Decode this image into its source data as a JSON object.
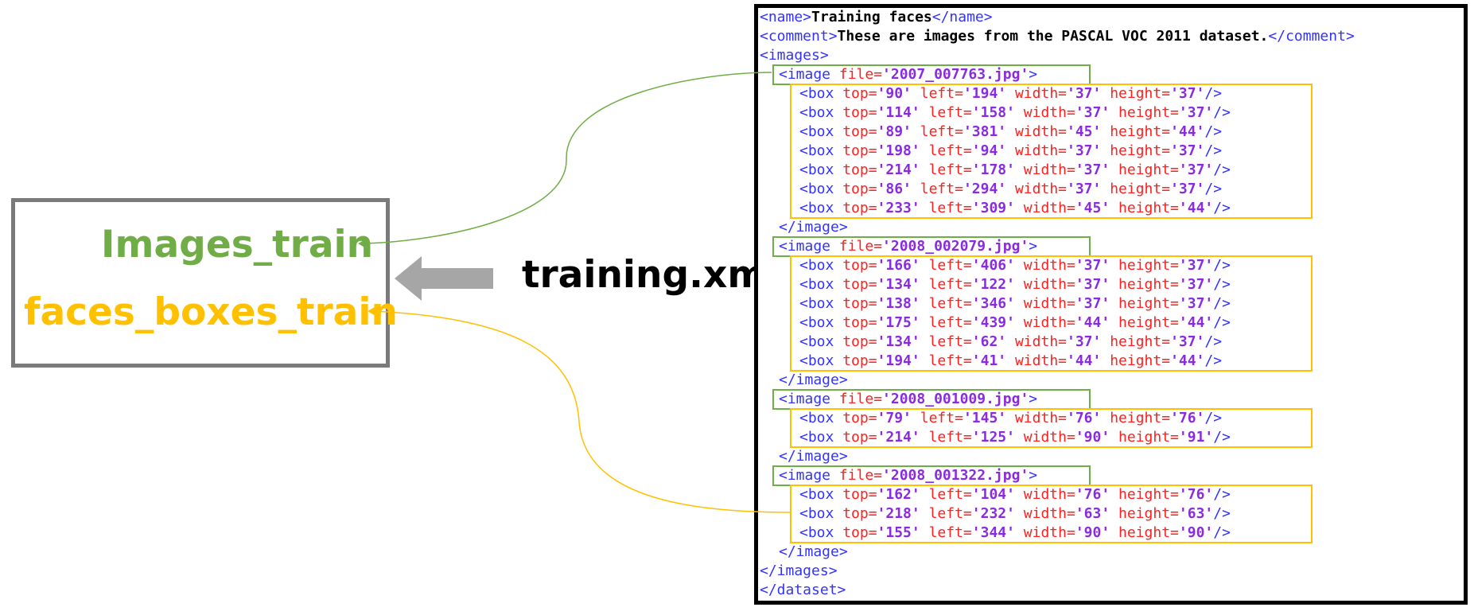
{
  "labels": {
    "images_train": "Images_train",
    "faces_boxes_train": "faces_boxes_train",
    "training_xml": "training.xml"
  },
  "colors": {
    "images": "#70ad47",
    "boxes": "#ffc000",
    "tag": "#3333ff",
    "attr": "#ff2020",
    "value": "#8a2be2",
    "arrow": "#a6a6a6"
  },
  "xml": {
    "name": "Training faces",
    "comment": "These are images from the PASCAL VOC 2011 dataset.",
    "images": [
      {
        "file": "2007_007763.jpg",
        "boxes": [
          {
            "top": "90",
            "left": "194",
            "width": "37",
            "height": "37"
          },
          {
            "top": "114",
            "left": "158",
            "width": "37",
            "height": "37"
          },
          {
            "top": "89",
            "left": "381",
            "width": "45",
            "height": "44"
          },
          {
            "top": "198",
            "left": "94",
            "width": "37",
            "height": "37"
          },
          {
            "top": "214",
            "left": "178",
            "width": "37",
            "height": "37"
          },
          {
            "top": "86",
            "left": "294",
            "width": "37",
            "height": "37"
          },
          {
            "top": "233",
            "left": "309",
            "width": "45",
            "height": "44"
          }
        ]
      },
      {
        "file": "2008_002079.jpg",
        "boxes": [
          {
            "top": "166",
            "left": "406",
            "width": "37",
            "height": "37"
          },
          {
            "top": "134",
            "left": "122",
            "width": "37",
            "height": "37"
          },
          {
            "top": "138",
            "left": "346",
            "width": "37",
            "height": "37"
          },
          {
            "top": "175",
            "left": "439",
            "width": "44",
            "height": "44"
          },
          {
            "top": "134",
            "left": "62",
            "width": "37",
            "height": "37"
          },
          {
            "top": "194",
            "left": "41",
            "width": "44",
            "height": "44"
          }
        ]
      },
      {
        "file": "2008_001009.jpg",
        "boxes": [
          {
            "top": "79",
            "left": "145",
            "width": "76",
            "height": "76"
          },
          {
            "top": "214",
            "left": "125",
            "width": "90",
            "height": "91"
          }
        ]
      },
      {
        "file": "2008_001322.jpg",
        "boxes": [
          {
            "top": "162",
            "left": "104",
            "width": "76",
            "height": "76"
          },
          {
            "top": "218",
            "left": "232",
            "width": "63",
            "height": "63"
          },
          {
            "top": "155",
            "left": "344",
            "width": "90",
            "height": "90"
          }
        ]
      }
    ]
  }
}
